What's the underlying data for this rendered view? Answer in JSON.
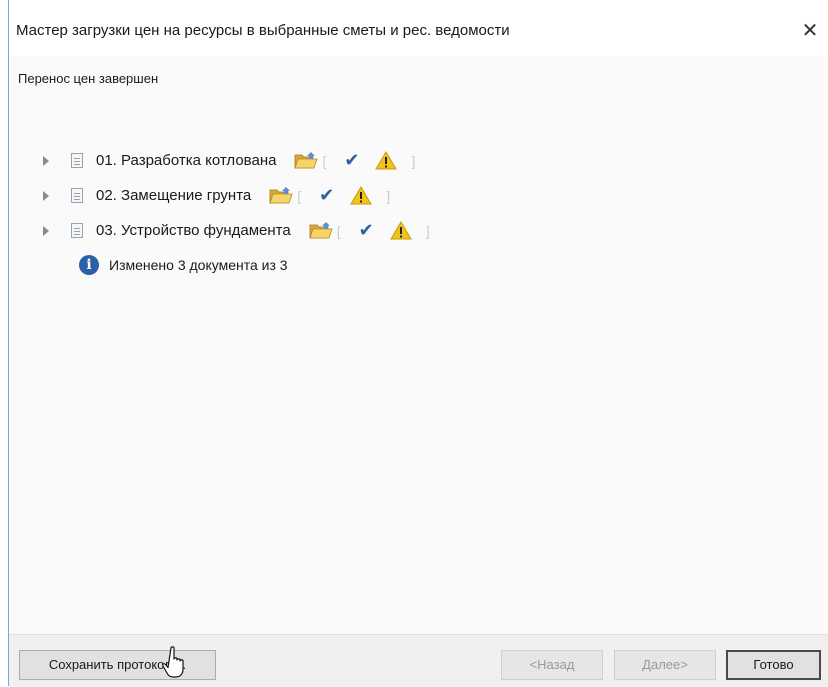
{
  "window": {
    "title": "Мастер загрузки цен на ресурсы в выбранные сметы и рес. ведомости",
    "close_glyph": "✕"
  },
  "status": {
    "heading": "Перенос цен завершен"
  },
  "documents": [
    {
      "name": "01. Разработка котлована",
      "icons": [
        "folder-open-icon",
        "check-icon",
        "warning-icon"
      ]
    },
    {
      "name": "02. Замещение грунта",
      "icons": [
        "folder-open-icon",
        "check-icon",
        "warning-icon"
      ]
    },
    {
      "name": "03. Устройство фундамента",
      "icons": [
        "folder-open-icon",
        "check-icon",
        "warning-icon"
      ]
    }
  ],
  "glyphs": {
    "check": "✔",
    "bracket_open": "[",
    "bracket_close": "]",
    "info": "i"
  },
  "summary": {
    "text": "Изменено 3 документа из 3"
  },
  "buttons": {
    "save": "Сохранить протокол ...",
    "back": "<Назад",
    "next": "Далее>",
    "done": "Готово"
  },
  "colors": {
    "accent": "#2b5fa8",
    "check": "#2f5fa0",
    "warning": "#f2c318"
  }
}
